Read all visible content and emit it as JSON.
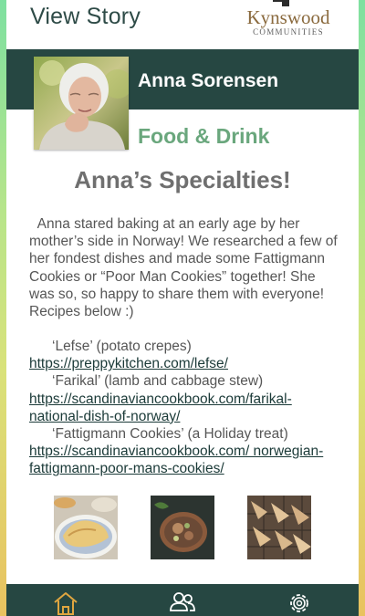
{
  "header": {
    "title": "View Story"
  },
  "logo": {
    "name": "Kynswood",
    "subtitle": "COMMUNITIES"
  },
  "resident": {
    "name": "Anna Sorensen",
    "photo": "elderly-woman-portrait"
  },
  "category": "Food & Drink",
  "story": {
    "title": "Anna’s Specialties!",
    "body": "Anna stared baking at an early age by her mother’s side in Norway! We researched a few of her fondest dishes and made some Fattigmann Cookies or “Poor Man Cookies” together! She was so, so happy to share them with everyone! Recipes below :)"
  },
  "recipes": [
    {
      "name": "‘Lefse’ (potato crepes)",
      "url": "https://preppykitchen.com/lefse/"
    },
    {
      "name": "‘Farikal’ (lamb and cabbage stew)",
      "url": "https://scandinaviancookbook.com/farikal-national-dish-of-norway/"
    },
    {
      "name": "‘Fattigmann Cookies’ (a Holiday treat)",
      "url": "https://scandinaviancookbook.com/ norwegian-fattigmann-poor-mans-cookies/"
    }
  ],
  "photos": [
    "lefse-plate-photo",
    "farikal-stew-photo",
    "fattigmann-cookies-photo"
  ],
  "nav": {
    "icons": [
      "home-icon",
      "people-icon",
      "settings-icon"
    ],
    "active_color": "#e0a640"
  },
  "colors": {
    "primary": "#264742",
    "accent_green": "#6aa77d",
    "logo_brown": "#8a6a3e"
  }
}
